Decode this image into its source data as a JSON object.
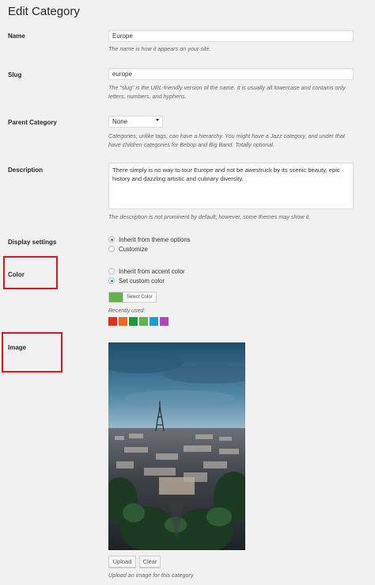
{
  "page": {
    "title": "Edit Category"
  },
  "name": {
    "label": "Name",
    "value": "Europe",
    "help": "The name is how it appears on your site."
  },
  "slug": {
    "label": "Slug",
    "value": "europe",
    "help_line1": "The “slug” is the URL-friendly version of the name. It is usually all lowercase and contains only",
    "help_line2": "letters, numbers, and hyphens."
  },
  "parent": {
    "label": "Parent Category",
    "selected": "None",
    "help_line1": "Categories, unlike tags, can have a hierarchy. You might have a Jazz category, and under that",
    "help_line2": "have children categories for Bebop and Big Band. Totally optional."
  },
  "description": {
    "label": "Description",
    "value": "There simply is no way to tour Europe and not be awestruck by its scenic beauty, epic history and dazzling artistic and culinary diversity.",
    "help": "The description is not prominent by default; however, some themes may show it."
  },
  "display_settings": {
    "label": "Display settings",
    "options": [
      "Inherit from theme options",
      "Customize"
    ],
    "selected_index": 0
  },
  "color": {
    "label": "Color",
    "options": [
      "Inherit from accent color",
      "Set custom color"
    ],
    "selected_index": 1,
    "current_color": "#63b34d",
    "select_button": "Select Color",
    "recently_used_label": "Recently used:",
    "recent_colors": [
      "#e2311d",
      "#f26522",
      "#1a9b3d",
      "#63b34d",
      "#1e9bd7",
      "#b545b5"
    ]
  },
  "image": {
    "label": "Image",
    "upload_button": "Upload",
    "clear_button": "Clear",
    "help": "Upload an image for this category"
  },
  "colors": {
    "highlight": "#e3131b",
    "radio_checked": "#1e8cbe"
  }
}
